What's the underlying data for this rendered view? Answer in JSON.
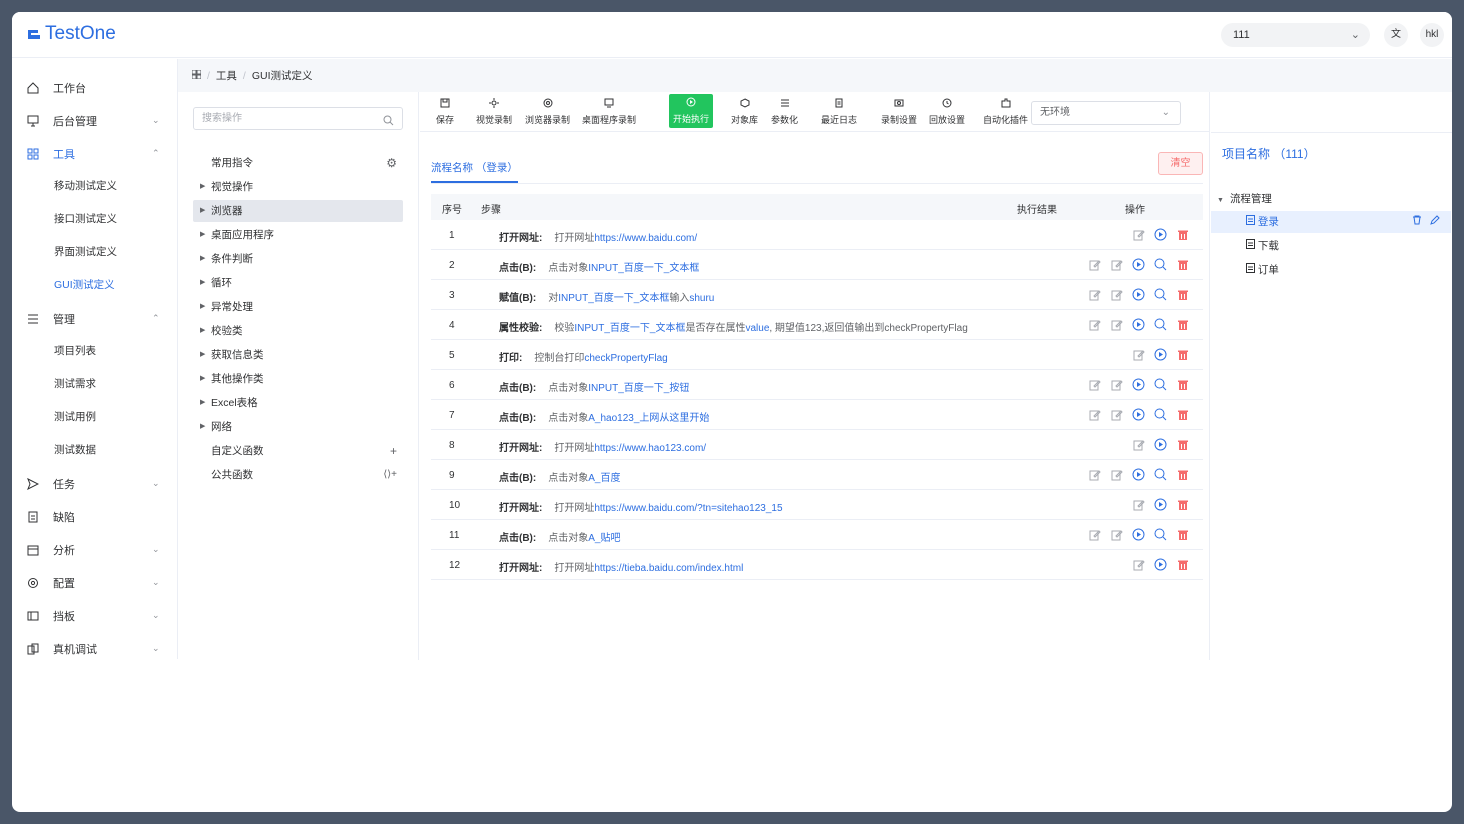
{
  "header": {
    "logo_text": "TestOne",
    "project_select": "111",
    "lang_icon": "translate-icon",
    "user": "hkl"
  },
  "nav": {
    "items": [
      {
        "label": "工作台",
        "icon": "home-icon"
      },
      {
        "label": "后台管理",
        "icon": "monitor-icon"
      },
      {
        "label": "工具",
        "icon": "grid-icon"
      },
      {
        "label": "管理",
        "icon": "list-icon"
      },
      {
        "label": "任务",
        "icon": "send-icon"
      },
      {
        "label": "缺陷",
        "icon": "doc-icon"
      },
      {
        "label": "分析",
        "icon": "calendar-icon"
      },
      {
        "label": "配置",
        "icon": "gear-icon"
      },
      {
        "label": "挡板",
        "icon": "panel-icon"
      },
      {
        "label": "真机调试",
        "icon": "device-icon"
      }
    ],
    "tool_sub": [
      "移动测试定义",
      "接口测试定义",
      "界面测试定义",
      "GUI测试定义"
    ],
    "manage_sub": [
      "项目列表",
      "测试需求",
      "测试用例",
      "测试数据"
    ]
  },
  "breadcrumb": {
    "home_icon": "grid-icon",
    "items": [
      "工具",
      "GUI测试定义"
    ],
    "sep": "/"
  },
  "ops_panel": {
    "search_placeholder": "搜索操作",
    "tree": [
      "常用指令",
      "视觉操作",
      "浏览器",
      "桌面应用程序",
      "条件判断",
      "循环",
      "异常处理",
      "校验类",
      "获取信息类",
      "其他操作类",
      "Excel表格",
      "网络",
      "自定义函数",
      "公共函数"
    ],
    "custom_add": "+",
    "public_add": "⟨⟩+"
  },
  "toolbar": {
    "items": [
      "保存",
      "视觉录制",
      "浏览器录制",
      "桌面程序录制",
      "开始执行",
      "对象库",
      "参数化",
      "最近日志",
      "录制设置",
      "回放设置",
      "自动化插件"
    ],
    "env": "无环境"
  },
  "flow": {
    "tab": "流程名称 （登录）",
    "clear": "清空",
    "columns": {
      "no": "序号",
      "step": "步骤",
      "result": "执行结果",
      "ops": "操作"
    },
    "rows": [
      {
        "no": "1",
        "kw": "打开网址:",
        "pre": "打开网址",
        "link": "https://www.baidu.com/",
        "mid": "",
        "link2": "",
        "post": ""
      },
      {
        "no": "2",
        "kw": "点击(B):",
        "pre": "点击对象",
        "link": "INPUT_百度一下_文本框",
        "mid": "",
        "link2": "",
        "post": ""
      },
      {
        "no": "3",
        "kw": "赋值(B):",
        "pre": "对",
        "link": "INPUT_百度一下_文本框",
        "mid": "输入",
        "link2": "shuru",
        "post": ""
      },
      {
        "no": "4",
        "kw": "属性校验:",
        "pre": "校验",
        "link": "INPUT_百度一下_文本框",
        "mid": "是否存在属性",
        "link2": "value",
        "post": ", 期望值123,返回值输出到checkPropertyFlag"
      },
      {
        "no": "5",
        "kw": "打印:",
        "pre": "控制台打印",
        "link": "checkPropertyFlag",
        "mid": "",
        "link2": "",
        "post": ""
      },
      {
        "no": "6",
        "kw": "点击(B):",
        "pre": "点击对象",
        "link": "INPUT_百度一下_按钮",
        "mid": "",
        "link2": "",
        "post": ""
      },
      {
        "no": "7",
        "kw": "点击(B):",
        "pre": "点击对象",
        "link": "A_hao123_上网从这里开始",
        "mid": "",
        "link2": "",
        "post": ""
      },
      {
        "no": "8",
        "kw": "打开网址:",
        "pre": "打开网址",
        "link": "https://www.hao123.com/",
        "mid": "",
        "link2": "",
        "post": ""
      },
      {
        "no": "9",
        "kw": "点击(B):",
        "pre": "点击对象",
        "link": "A_百度",
        "mid": "",
        "link2": "",
        "post": ""
      },
      {
        "no": "10",
        "kw": "打开网址:",
        "pre": "打开网址",
        "link": "https://www.baidu.com/?tn=sitehao123_15",
        "mid": "",
        "link2": "",
        "post": ""
      },
      {
        "no": "11",
        "kw": "点击(B):",
        "pre": "点击对象",
        "link": "A_贴吧",
        "mid": "",
        "link2": "",
        "post": ""
      },
      {
        "no": "12",
        "kw": "打开网址:",
        "pre": "打开网址",
        "link": "https://tieba.baidu.com/index.html",
        "mid": "",
        "link2": "",
        "post": ""
      }
    ]
  },
  "project": {
    "title": "项目名称 （111）",
    "root": "流程管理",
    "flows": [
      "登录",
      "下载",
      "订单"
    ]
  },
  "colors": {
    "accent": "#2d6ee0",
    "run": "#22c55e",
    "danger": "#f56c6c"
  }
}
